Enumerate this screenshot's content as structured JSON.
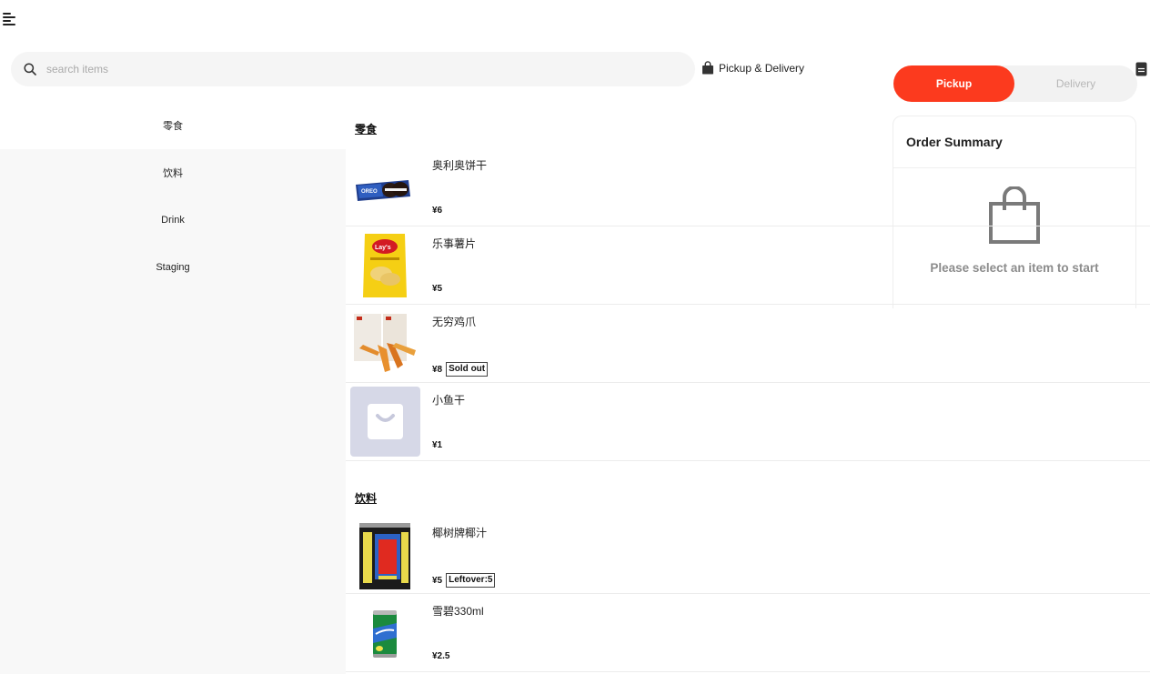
{
  "search": {
    "placeholder": "search items"
  },
  "header": {
    "pickup_delivery_label": "Pickup & Delivery"
  },
  "mode_toggle": {
    "pickup": "Pickup",
    "delivery": "Delivery",
    "selected": "Pickup"
  },
  "order_summary": {
    "title": "Order Summary",
    "empty_text": "Please select an item to start"
  },
  "categories": [
    {
      "label": "零食",
      "active": true
    },
    {
      "label": "饮料",
      "active": false
    },
    {
      "label": "Drink",
      "active": false
    },
    {
      "label": "Staging",
      "active": false
    }
  ],
  "sections": [
    {
      "title": "零食",
      "items": [
        {
          "name": "奥利奥饼干",
          "price": "¥6",
          "badge": "",
          "icon": "cookie-package-image"
        },
        {
          "name": "乐事薯片",
          "price": "¥5",
          "badge": "",
          "icon": "chips-bag-image"
        },
        {
          "name": "无穷鸡爪",
          "price": "¥8",
          "badge": "Sold out",
          "icon": "chicken-feet-image"
        },
        {
          "name": "小鱼干",
          "price": "¥1",
          "badge": "",
          "icon": "placeholder-bag-icon"
        }
      ]
    },
    {
      "title": "饮料",
      "items": [
        {
          "name": "椰树牌椰汁",
          "price": "¥5",
          "badge": "Leftover:5",
          "icon": "coconut-juice-can-image"
        },
        {
          "name": "雪碧330ml",
          "price": "¥2.5",
          "badge": "",
          "icon": "sprite-can-image"
        }
      ]
    }
  ],
  "colors": {
    "accent": "#fc3a1e",
    "sidebar_bg": "#f8f8f8",
    "search_bg": "#f5f5f5",
    "muted_text": "#8c8c8c"
  }
}
